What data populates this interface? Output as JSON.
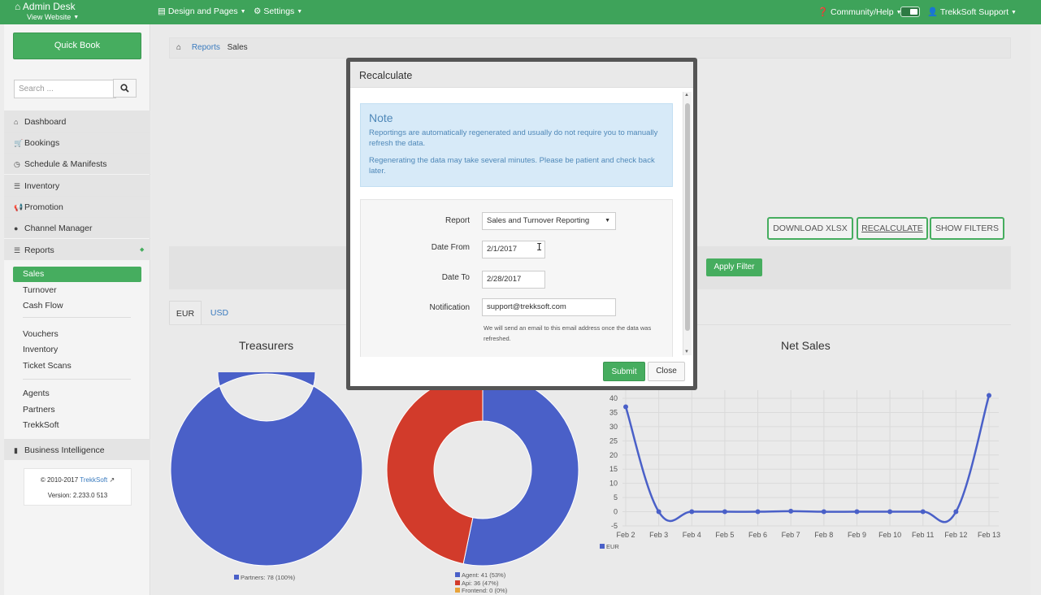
{
  "topbar": {
    "brand": "Admin Desk",
    "brand_sub": "View Website",
    "design_pages": "Design and Pages",
    "settings": "Settings",
    "community": "Community/Help",
    "user": "TrekkSoft Support"
  },
  "sidebar": {
    "quick_book": "Quick Book",
    "search_placeholder": "Search ...",
    "menu": [
      {
        "label": "Dashboard",
        "icon": "home-icon"
      },
      {
        "label": "Bookings",
        "icon": "cart-icon"
      },
      {
        "label": "Schedule & Manifests",
        "icon": "clock-icon"
      },
      {
        "label": "Inventory",
        "icon": "list-icon"
      },
      {
        "label": "Promotion",
        "icon": "bullhorn-icon"
      },
      {
        "label": "Channel Manager",
        "icon": "globe-icon"
      },
      {
        "label": "Reports",
        "icon": "list-icon"
      }
    ],
    "reports_sub": [
      "Sales",
      "Turnover",
      "Cash Flow"
    ],
    "group2": [
      "Vouchers",
      "Inventory",
      "Ticket Scans"
    ],
    "group3": [
      "Agents",
      "Partners",
      "TrekkSoft"
    ],
    "business_intelligence": "Business Intelligence",
    "copyright": "© 2010-2017",
    "copyright_link": "TrekkSoft",
    "version": "Version: 2.233.0 513"
  },
  "breadcrumb": {
    "reports": "Reports",
    "current": "Sales"
  },
  "toolbar": {
    "download": "DOWNLOAD  XLSX",
    "recalculate": "RECALCULATE",
    "show_filters": "SHOW FILTERS",
    "apply_filter": "Apply Filter"
  },
  "tabs": [
    "EUR",
    "USD"
  ],
  "charts": {
    "treasurers_title": "Treasurers",
    "net_sales_title": "Net Sales"
  },
  "modal": {
    "title": "Recalculate",
    "note_title": "Note",
    "note_p1": "Reportings are automatically regenerated and usually do not require you to manually refresh the data.",
    "note_p2": "Regenerating the data may take several minutes. Please be patient and check back later.",
    "report_label": "Report",
    "report_value": "Sales and Turnover Reporting",
    "date_from_label": "Date From",
    "date_from_value": "2/1/2017",
    "date_to_label": "Date To",
    "date_to_value": "2/28/2017",
    "notification_label": "Notification",
    "notification_value": "support@trekksoft.com",
    "notification_help": "We will send an email to this email address once the data was refreshed.",
    "submit": "Submit",
    "close": "Close"
  },
  "colors": {
    "accent": "#46ad5f",
    "blue": "#4a60c8",
    "red": "#d23b2b",
    "orange": "#e8a33a"
  },
  "chart_data": [
    {
      "type": "pie",
      "title": "Treasurers",
      "labels": [
        "Partners"
      ],
      "values": [
        78
      ],
      "legend": [
        "Partners: 78 (100%)"
      ],
      "colors": [
        "#4a60c8"
      ]
    },
    {
      "type": "pie",
      "title": "",
      "labels": [
        "Agent",
        "Api",
        "Frontend"
      ],
      "values": [
        41,
        36,
        0
      ],
      "legend": [
        "Agent: 41 (53%)",
        "Api: 36 (47%)",
        "Frontend: 0 (0%)"
      ],
      "colors": [
        "#4a60c8",
        "#d23b2b",
        "#e8a33a"
      ]
    },
    {
      "type": "line",
      "title": "Net Sales",
      "categories": [
        "Feb 2",
        "Feb 3",
        "Feb 4",
        "Feb 5",
        "Feb 6",
        "Feb 7",
        "Feb 8",
        "Feb 9",
        "Feb 10",
        "Feb 11",
        "Feb 12",
        "Feb 13"
      ],
      "series": [
        {
          "name": "EUR",
          "values": [
            37,
            0,
            0,
            0,
            0,
            0.2,
            0,
            0,
            0,
            0,
            0,
            41
          ]
        }
      ],
      "yticks": [
        -5,
        0,
        5,
        10,
        15,
        20,
        25,
        30,
        35,
        40
      ],
      "ylim": [
        -5,
        40
      ],
      "legend": [
        "EUR"
      ],
      "grid": true
    }
  ]
}
